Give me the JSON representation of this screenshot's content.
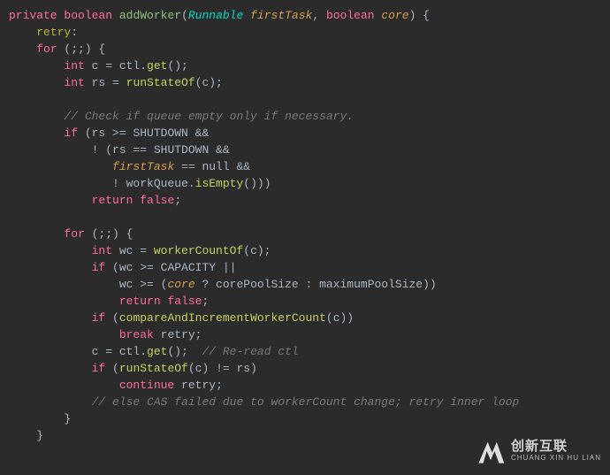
{
  "code": {
    "l1": {
      "kw1": "private",
      "kw2": "boolean",
      "fn": "addWorker",
      "p": "(",
      "ptype1": "Runnable",
      "pname1": "firstTask",
      "c1": ", ",
      "ptype2": "boolean",
      "pname2": "core",
      "p2": ") {"
    },
    "l2": {
      "label": "retry",
      "colon": ":"
    },
    "l3": {
      "kw": "for",
      "rest": " (;;) {"
    },
    "l4": {
      "type": "int",
      "rest": " c = ctl.",
      "call": "get",
      "paren": "();"
    },
    "l5": {
      "type": "int",
      "rest": " rs = ",
      "call": "runStateOf",
      "paren": "(c);"
    },
    "l6": {
      "comment": "// Check if queue empty only if necessary."
    },
    "l7": {
      "kw": "if",
      "rest": " (rs >= SHUTDOWN &&"
    },
    "l8": {
      "rest": "! (rs == SHUTDOWN &&"
    },
    "l9": {
      "idref": "firstTask",
      "rest": " == null &&"
    },
    "l10": {
      "rest": "! workQueue.",
      "call": "isEmpty",
      "paren": "()))"
    },
    "l11": {
      "kw": "return",
      "val": " false",
      "semi": ";"
    },
    "l12": {
      "kw": "for",
      "rest": " (;;) {"
    },
    "l13": {
      "type": "int",
      "rest": " wc = ",
      "call": "workerCountOf",
      "paren": "(c);"
    },
    "l14": {
      "kw": "if",
      "rest": " (wc >= CAPACITY ||"
    },
    "l15": {
      "rest1": "wc >= (",
      "idref": "core",
      "rest2": " ? corePoolSize : maximumPoolSize))"
    },
    "l16": {
      "kw": "return",
      "val": " false",
      "semi": ";"
    },
    "l17": {
      "kw": "if",
      "rest": " (",
      "call": "compareAndIncrementWorkerCount",
      "paren": "(c))"
    },
    "l18": {
      "kw": "break",
      "lbl": " retry",
      "semi": ";"
    },
    "l19": {
      "rest": "c = ctl.",
      "call": "get",
      "paren": "();  ",
      "comment": "// Re-read ctl"
    },
    "l20": {
      "kw": "if",
      "rest": " (",
      "call": "runStateOf",
      "paren": "(c) != rs)"
    },
    "l21": {
      "kw": "continue",
      "lbl": " retry",
      "semi": ";"
    },
    "l22": {
      "comment": "// else CAS failed due to workerCount change; retry inner loop"
    },
    "l23": {
      "brace": "}"
    },
    "l24": {
      "brace": "}"
    }
  },
  "watermark": {
    "cn": "创新互联",
    "en": "CHUANG XIN HU LIAN"
  }
}
